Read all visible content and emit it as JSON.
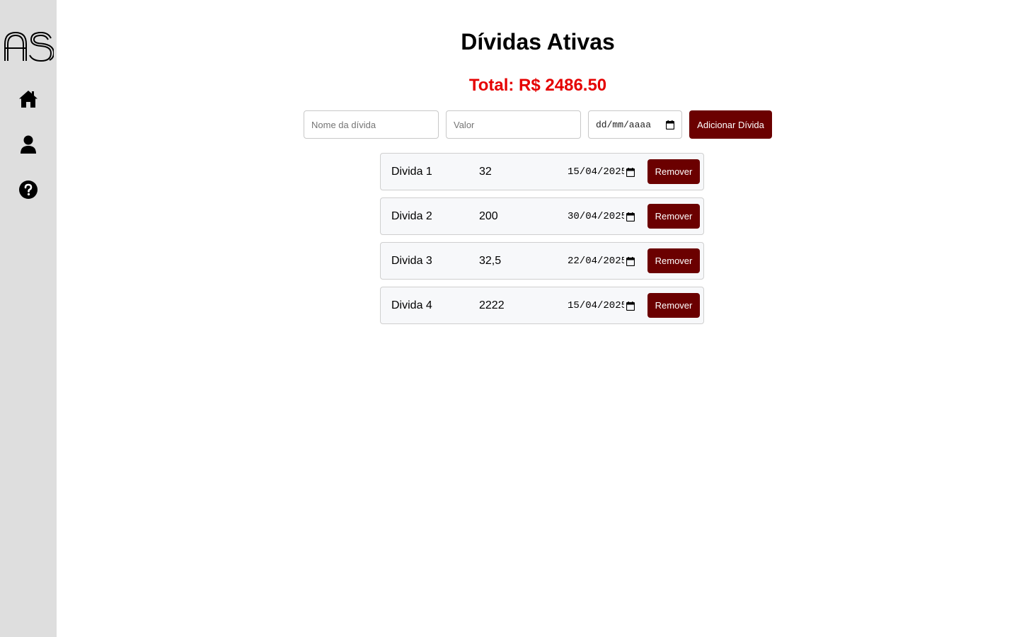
{
  "sidebar": {
    "logo_text": "AS",
    "items": [
      {
        "icon": "home-icon"
      },
      {
        "icon": "user-icon"
      },
      {
        "icon": "help-icon"
      }
    ]
  },
  "header": {
    "title": "Dívidas Ativas",
    "total": "Total: R$ 2486.50"
  },
  "form": {
    "name_placeholder": "Nome da dívida",
    "value_placeholder": "Valor",
    "date_placeholder": "dd/mm/aaaa",
    "add_label": "Adicionar Dívida"
  },
  "debts": [
    {
      "name": "Divida 1",
      "value": "32",
      "date": "15/04/2025",
      "remove_label": "Remover"
    },
    {
      "name": "Divida 2",
      "value": "200",
      "date": "30/04/2025",
      "remove_label": "Remover"
    },
    {
      "name": "Divida 3",
      "value": "32,5",
      "date": "22/04/2025",
      "remove_label": "Remover"
    },
    {
      "name": "Divida 4",
      "value": "2222",
      "date": "15/04/2025",
      "remove_label": "Remover"
    }
  ],
  "colors": {
    "accent": "#6b0000",
    "total": "#e50000",
    "sidebar": "#dedede"
  }
}
